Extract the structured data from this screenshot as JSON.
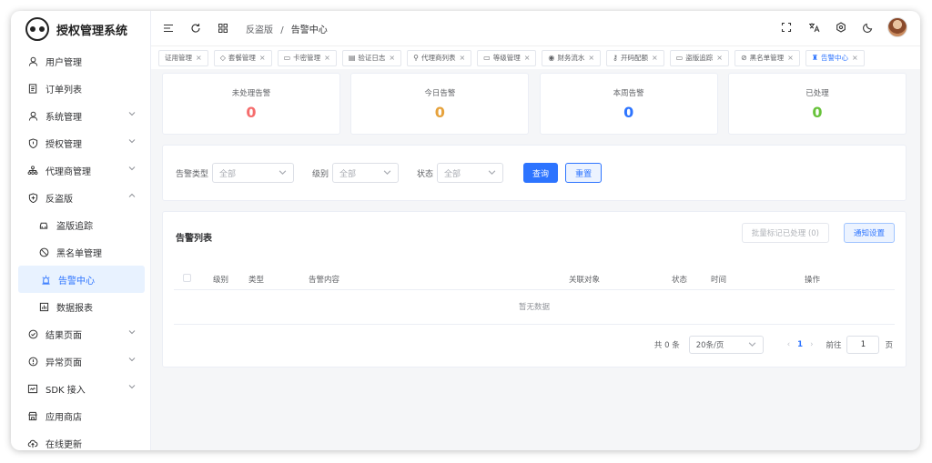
{
  "app": {
    "title": "授权管理系统"
  },
  "sidebar": {
    "items": [
      {
        "label": "用户管理",
        "icon": "user-icon"
      },
      {
        "label": "订单列表",
        "icon": "document-icon"
      },
      {
        "label": "系统管理",
        "icon": "user-icon",
        "expandable": true
      },
      {
        "label": "授权管理",
        "icon": "shield-icon",
        "expandable": true
      },
      {
        "label": "代理商管理",
        "icon": "org-icon",
        "expandable": true
      },
      {
        "label": "反盗版",
        "icon": "shield-plus-icon",
        "expanded": true
      },
      {
        "label": "盗版追踪",
        "icon": "car-icon",
        "sub": true
      },
      {
        "label": "黑名单管理",
        "icon": "ban-icon",
        "sub": true
      },
      {
        "label": "告警中心",
        "icon": "alarm-icon",
        "sub": true,
        "active": true
      },
      {
        "label": "数据报表",
        "icon": "chart-icon",
        "sub": true
      },
      {
        "label": "结果页面",
        "icon": "check-circle-icon",
        "expandable": true
      },
      {
        "label": "异常页面",
        "icon": "warning-icon",
        "expandable": true
      },
      {
        "label": "SDK 接入",
        "icon": "code-icon",
        "expandable": true
      },
      {
        "label": "应用商店",
        "icon": "shop-icon"
      },
      {
        "label": "在线更新",
        "icon": "cloud-icon"
      }
    ]
  },
  "header": {
    "breadcrumb": [
      "反盗版",
      "告警中心"
    ]
  },
  "tabs": [
    {
      "label": "证用管理",
      "icon": ""
    },
    {
      "label": "套餐管理",
      "icon": "◇"
    },
    {
      "label": "卡密管理",
      "icon": "▭"
    },
    {
      "label": "验证日志",
      "icon": "▤"
    },
    {
      "label": "代理商列表",
      "icon": "⚲"
    },
    {
      "label": "等级管理",
      "icon": "▭"
    },
    {
      "label": "财务流水",
      "icon": "◉"
    },
    {
      "label": "开码配额",
      "icon": "⚷"
    },
    {
      "label": "盗版追踪",
      "icon": "▭"
    },
    {
      "label": "黑名单管理",
      "icon": "⊘"
    },
    {
      "label": "告警中心",
      "icon": "♜",
      "active": true
    }
  ],
  "stats": [
    {
      "label": "未处理告警",
      "value": "0",
      "color": "#f56c6c"
    },
    {
      "label": "今日告警",
      "value": "0",
      "color": "#e6a23c"
    },
    {
      "label": "本周告警",
      "value": "0",
      "color": "#2d74ff"
    },
    {
      "label": "已处理",
      "value": "0",
      "color": "#67c23a"
    }
  ],
  "filter": {
    "type_label": "告警类型",
    "type_placeholder": "全部",
    "level_label": "级别",
    "level_placeholder": "全部",
    "status_label": "状态",
    "status_placeholder": "全部",
    "query": "查询",
    "reset": "重置"
  },
  "list": {
    "title": "告警列表",
    "batch_button": "批量标记已处理 (0)",
    "notify_button": "通知设置",
    "columns": [
      "级别",
      "类型",
      "告警内容",
      "关联对象",
      "状态",
      "时间",
      "操作"
    ],
    "empty_text": "暂无数据"
  },
  "pagination": {
    "total": "共 0 条",
    "page_size": "20条/页",
    "prev": "‹",
    "current": "1",
    "next": "›",
    "goto": "前往",
    "goto_value": "1",
    "page_unit": "页"
  }
}
